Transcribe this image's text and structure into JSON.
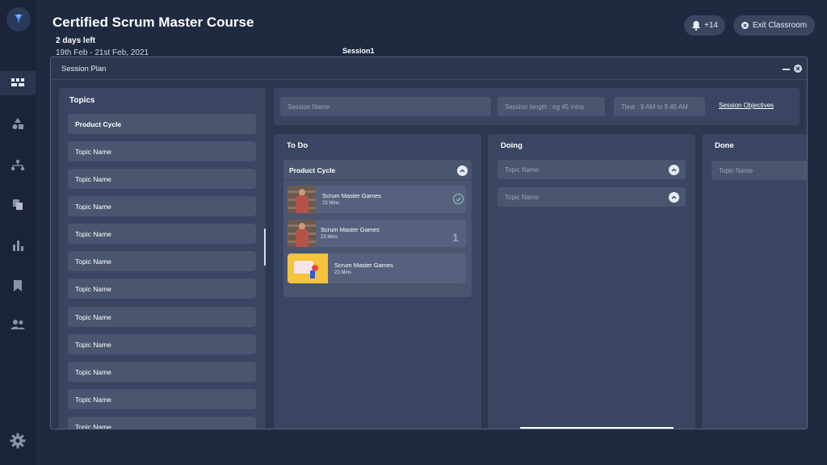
{
  "header": {
    "course_title": "Certified Scrum Master Course",
    "days_left": "2 days left",
    "date_range": "19th Feb - 21st Feb, 2021",
    "session_label": "Session1",
    "notifications": "+14",
    "exit_label": "Exit Classroom"
  },
  "rail": {
    "icons": [
      "logo-icon",
      "dashboard-icon",
      "shapes-icon",
      "hierarchy-icon",
      "documents-icon",
      "bar-chart-icon",
      "bookmark-icon",
      "people-icon",
      "settings-icon"
    ],
    "active": "dashboard-icon"
  },
  "dialog": {
    "title": "Session Plan"
  },
  "topics": {
    "title": "Topics",
    "items": [
      "Product Cycle",
      "Topic Name",
      "Topic Name",
      "Topic Name",
      "Topic Name",
      "Topic Name",
      "Topic Name",
      "Topic Name",
      "Topic Name",
      "Topic Name",
      "Topic Name",
      "Topic Name"
    ]
  },
  "session": {
    "name_placeholder": "Session Name",
    "length_placeholder": "Session length : eg 45 mins",
    "time_placeholder": "Time : 9 AM to 9.45 AM",
    "objectives_link": "Session Objectives"
  },
  "board": {
    "todo": {
      "title": "To Do",
      "group_title": "Product Cycle",
      "cards": [
        {
          "title": "Scrum Master Games",
          "duration": "23 Mins",
          "status": "check"
        },
        {
          "title": "Scrum Master Games",
          "duration": "23 Mins",
          "status": "1"
        },
        {
          "title": "Scrum Master Games",
          "duration": "23 Mins",
          "status": ""
        }
      ]
    },
    "doing": {
      "title": "Doing",
      "slots": [
        "Topic Name",
        "Topic Name"
      ]
    },
    "done": {
      "title": "Done",
      "slots": [
        "Topic Name"
      ]
    }
  },
  "colors": {
    "background": "#1f2a40",
    "panel": "#394561",
    "field": "#4a5670",
    "accent_check": "#8fc9c4"
  }
}
